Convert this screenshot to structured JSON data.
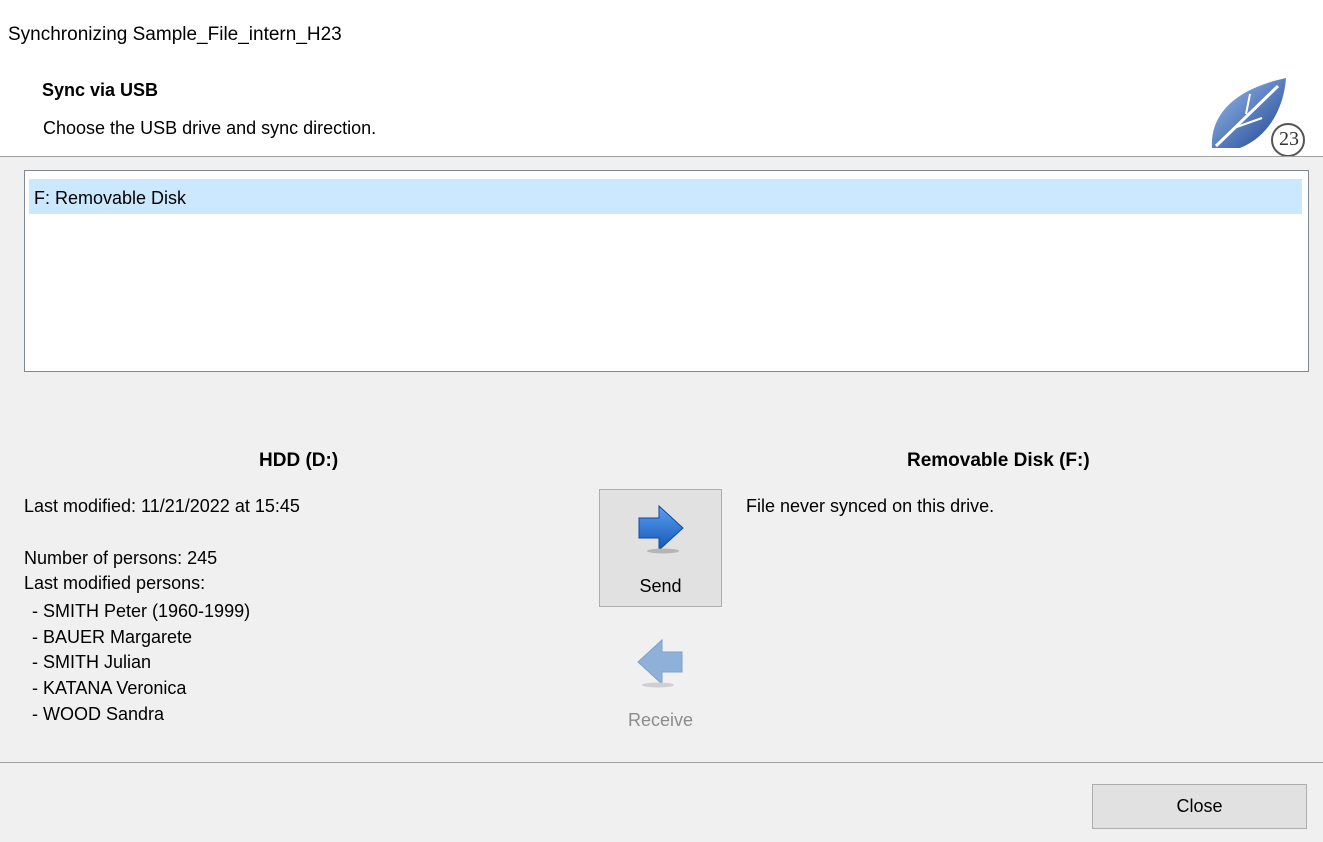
{
  "window": {
    "title": "Synchronizing Sample_File_intern_H23"
  },
  "header": {
    "title": "Sync via USB",
    "subtitle": "Choose the USB drive and sync direction.",
    "logo_icon": "leaf-logo-icon",
    "logo_text": "23"
  },
  "drives": {
    "items": [
      {
        "label": "F: Removable Disk",
        "selected": true
      }
    ]
  },
  "left": {
    "heading": "HDD (D:)",
    "last_modified": "Last modified: 11/21/2022 at 15:45",
    "num_persons": "Number of persons: 245",
    "last_modified_persons_label": "Last modified persons:",
    "persons": [
      "- SMITH Peter (1960-1999)",
      "- BAUER Margarete",
      "- SMITH Julian",
      "- KATANA Veronica",
      "- WOOD Sandra"
    ]
  },
  "right": {
    "heading": "Removable Disk (F:)",
    "status": "File never synced on this drive."
  },
  "actions": {
    "send_label": "Send",
    "send_icon": "arrow-right-icon",
    "receive_label": "Receive",
    "receive_icon": "arrow-left-icon",
    "receive_enabled": false
  },
  "footer": {
    "close_label": "Close"
  },
  "colors": {
    "selection": "#cce8ff",
    "arrow_active": "#1f6fd1",
    "arrow_disabled": "#8fb1d9"
  }
}
